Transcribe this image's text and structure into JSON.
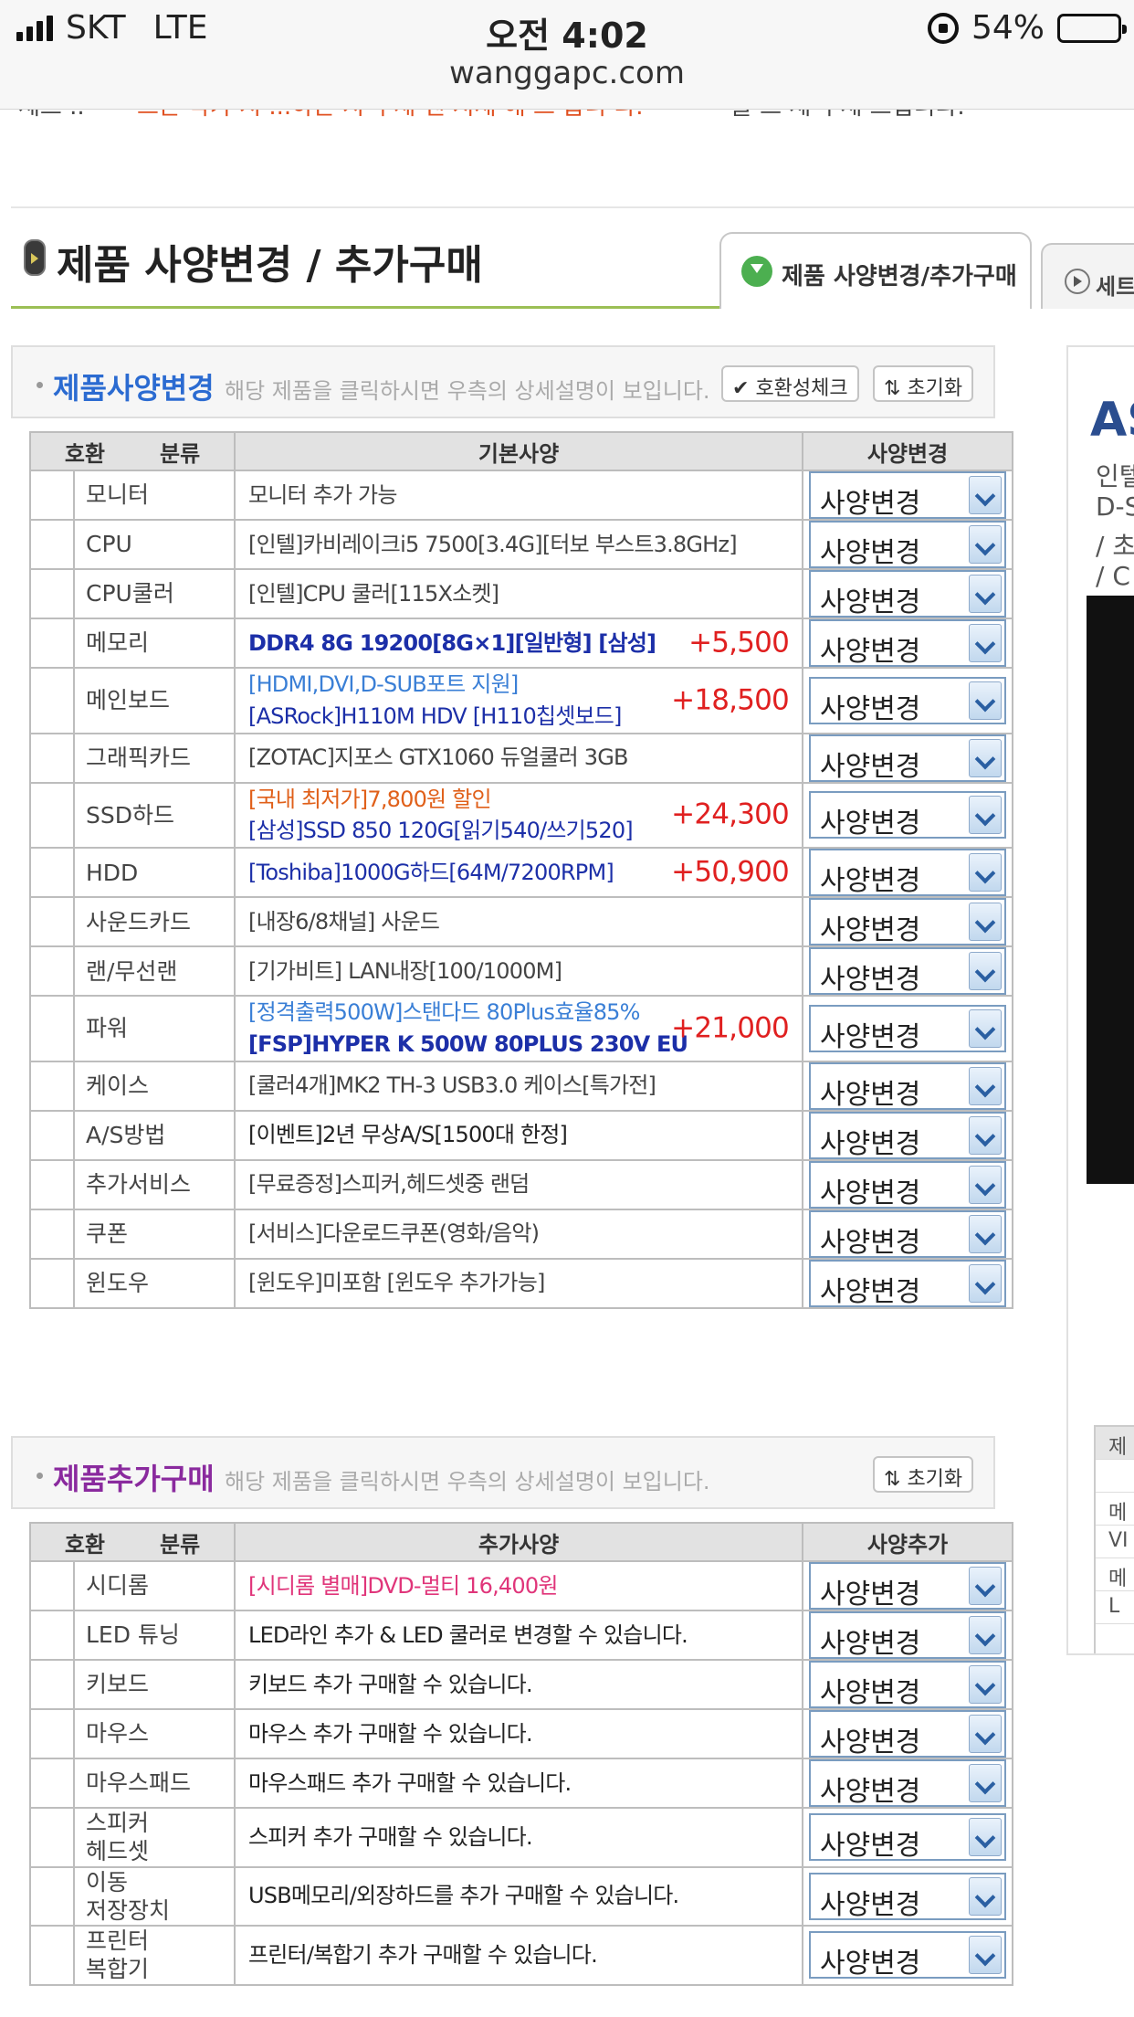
{
  "status_bar": {
    "carrier": "SKT",
    "network": "LTE",
    "time": "오전 4:02",
    "url": "wanggapc.com",
    "battery": "54%",
    "battery_level": 0.54
  },
  "cut_strip": {
    "left": "세트 .. ",
    "middle": "드는 약가 시 ...하는 시 주세 엔 시세 해 드 습니 다.",
    "right": "을 드 세 주세 드립니다."
  },
  "page_title": "제품 사양변경 / 추가구매",
  "tabs": [
    {
      "label": "제품 사양변경/추가구매"
    },
    {
      "label": "세트"
    }
  ],
  "section_change": {
    "title": "제품사양변경",
    "title_color": "#2b6bd1",
    "desc": "해당 제품을 클릭하시면 우측의 상세설명이 보입니다.",
    "compat_label": "호환성체크",
    "reset_label": "초기화",
    "headers": {
      "compat": "호환",
      "category": "분류",
      "spec": "기본사양",
      "action": "사양변경"
    },
    "select_value": "사양변경",
    "rows": [
      {
        "category": "모니터",
        "lines": [
          {
            "text": "모니터 추가 가능",
            "color": "#444"
          }
        ],
        "price": ""
      },
      {
        "category": "CPU",
        "lines": [
          {
            "text": "[인텔]카비레이크i5 7500[3.4G][터보 부스트3.8GHz]",
            "color": "#444"
          }
        ],
        "price": ""
      },
      {
        "category": "CPU쿨러",
        "lines": [
          {
            "text": "[인텔]CPU 쿨러[115X소켓]",
            "color": "#444"
          }
        ],
        "price": ""
      },
      {
        "category": "메모리",
        "lines": [
          {
            "text": "DDR4 8G 19200[8G×1][일반형] [삼성]",
            "color": "#1c2fa8",
            "bold": true
          }
        ],
        "price": "+5,500"
      },
      {
        "category": "메인보드",
        "lines": [
          {
            "text": "[HDMI,DVI,D-SUB포트 지원]",
            "color": "#3a7fd6"
          },
          {
            "text": "[ASRock]H110M HDV [H110칩셋보드]",
            "color": "#1c2fa8"
          }
        ],
        "price": "+18,500"
      },
      {
        "category": "그래픽카드",
        "lines": [
          {
            "text": "[ZOTAC]지포스 GTX1060 듀얼쿨러 3GB",
            "color": "#444"
          }
        ],
        "price": ""
      },
      {
        "category": "SSD하드",
        "lines": [
          {
            "text": "[국내 최저가]7,800원 할인",
            "color": "#e0601a"
          },
          {
            "text": "[삼성]SSD 850 120G[읽기540/쓰기520]",
            "color": "#1c2fa8"
          }
        ],
        "price": "+24,300"
      },
      {
        "category": "HDD",
        "lines": [
          {
            "text": "[Toshiba]1000G하드[64M/7200RPM]",
            "color": "#1c2fa8"
          }
        ],
        "price": "+50,900"
      },
      {
        "category": "사운드카드",
        "lines": [
          {
            "text": "[내장6/8채널] 사운드",
            "color": "#444"
          }
        ],
        "price": ""
      },
      {
        "category": "랜/무선랜",
        "lines": [
          {
            "text": "[기가비트] LAN내장[100/1000M]",
            "color": "#444"
          }
        ],
        "price": ""
      },
      {
        "category": "파워",
        "lines": [
          {
            "text": "[정격출력500W]스탠다드 80Plus효율85%",
            "color": "#3a7fd6"
          },
          {
            "text": "[FSP]HYPER K 500W 80PLUS 230V EU",
            "color": "#1c2fa8",
            "bold": true
          }
        ],
        "price": "+21,000"
      },
      {
        "category": "케이스",
        "lines": [
          {
            "text": "[쿨러4개]MK2 TH-3 USB3.0 케이스[특가전]",
            "color": "#444"
          }
        ],
        "price": ""
      },
      {
        "category": "A/S방법",
        "lines": [
          {
            "text": "[이벤트]2년 무상A/S[1500대 한정]",
            "color": "#222"
          }
        ],
        "price": ""
      },
      {
        "category": "추가서비스",
        "lines": [
          {
            "text": "[무료증정]스피커,헤드셋중 랜덤",
            "color": "#444"
          }
        ],
        "price": ""
      },
      {
        "category": "쿠폰",
        "lines": [
          {
            "text": "[서비스]다운로드쿠폰(영화/음악)",
            "color": "#444"
          }
        ],
        "price": ""
      },
      {
        "category": "윈도우",
        "lines": [
          {
            "text": "[윈도우]미포함 [윈도우 추가가능]",
            "color": "#444"
          }
        ],
        "price": ""
      }
    ]
  },
  "section_add": {
    "title": "제품추가구매",
    "title_color": "#8a2a9e",
    "desc": "해당 제품을 클릭하시면 우측의 상세설명이 보입니다.",
    "reset_label": "초기화",
    "headers": {
      "compat": "호환",
      "category": "분류",
      "spec": "추가사양",
      "action": "사양추가"
    },
    "select_value": "사양변경",
    "rows": [
      {
        "category": "시디롬",
        "lines": [
          {
            "text": "[시디롬 별매]DVD-멀티 16,400원",
            "color": "#e0357a"
          }
        ]
      },
      {
        "category": "LED 튜닝",
        "lines": [
          {
            "text": "LED라인 추가 & LED 쿨러로 변경할 수 있습니다.",
            "color": "#222"
          }
        ]
      },
      {
        "category": "키보드",
        "lines": [
          {
            "text": "키보드 추가 구매할 수 있습니다.",
            "color": "#222"
          }
        ]
      },
      {
        "category": "마우스",
        "lines": [
          {
            "text": "마우스 추가 구매할 수 있습니다.",
            "color": "#222"
          }
        ]
      },
      {
        "category": "마우스패드",
        "lines": [
          {
            "text": "마우스패드 추가 구매할 수 있습니다.",
            "color": "#222"
          }
        ]
      },
      {
        "category": "스피커\n헤드셋",
        "lines": [
          {
            "text": "스피커 추가 구매할 수 있습니다.",
            "color": "#222"
          }
        ]
      },
      {
        "category": "이동\n저장장치",
        "lines": [
          {
            "text": "USB메모리/외장하드를 추가 구매할 수 있습니다.",
            "color": "#222"
          }
        ]
      },
      {
        "category": "프린터\n복합기",
        "lines": [
          {
            "text": "프린터/복합기 추가 구매할 수 있습니다.",
            "color": "#222"
          }
        ]
      }
    ]
  },
  "side_panel": {
    "brand": "AS",
    "lines": [
      "인텔",
      "D-S",
      "/ 초",
      "/ C"
    ],
    "table_rows": [
      "제",
      "",
      "메",
      "VI",
      "메",
      "L"
    ]
  }
}
